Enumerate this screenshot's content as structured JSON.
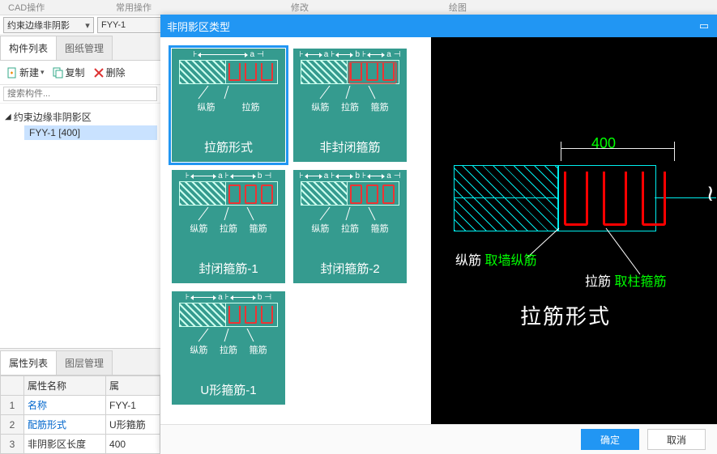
{
  "menu": {
    "cad": "CAD操作",
    "tools": "操作",
    "common": "常用操作",
    "mod": "修改",
    "draw": "绘图"
  },
  "combos": {
    "category": "约束边缘非阴影",
    "item": "FYY-1"
  },
  "left": {
    "tabs": {
      "components": "构件列表",
      "drawings": "图纸管理"
    },
    "toolbar": {
      "new": "新建",
      "copy": "复制",
      "delete": "删除"
    },
    "search_placeholder": "搜索构件...",
    "tree": {
      "root": "约束边缘非阴影区",
      "child": "FYY-1 [400]"
    }
  },
  "props": {
    "tabs": {
      "attrs": "属性列表",
      "layers": "图层管理"
    },
    "headers": {
      "name": "属性名称",
      "value": "属"
    },
    "rows": [
      {
        "n": "1",
        "k": "名称",
        "v": "FYY-1",
        "link": true
      },
      {
        "n": "2",
        "k": "配筋形式",
        "v": "U形箍筋",
        "link": true
      },
      {
        "n": "3",
        "k": "非阴影区长度",
        "v": "400",
        "link": false
      }
    ]
  },
  "dialog": {
    "title": "非阴影区类型",
    "ok": "确定",
    "cancel": "取消",
    "options": [
      {
        "title": "拉筋形式",
        "dims": [
          "a"
        ],
        "labels": [
          "纵筋",
          "拉筋"
        ],
        "bars": 3,
        "closed": false,
        "hoop": false
      },
      {
        "title": "非封闭箍筋",
        "dims": [
          "a",
          "b",
          "a"
        ],
        "labels": [
          "纵筋",
          "拉筋",
          "箍筋"
        ],
        "bars": 3,
        "closed": false,
        "hoop": true
      },
      {
        "title": "封闭箍筋-1",
        "dims": [
          "a",
          "b"
        ],
        "labels": [
          "纵筋",
          "拉筋",
          "箍筋"
        ],
        "bars": 3,
        "closed": true,
        "hoop": false
      },
      {
        "title": "封闭箍筋-2",
        "dims": [
          "a",
          "b",
          "a"
        ],
        "labels": [
          "纵筋",
          "拉筋",
          "箍筋"
        ],
        "bars": 3,
        "closed": true,
        "hoop": false
      },
      {
        "title": "U形箍筋-1",
        "dims": [
          "a",
          "b"
        ],
        "labels": [
          "纵筋",
          "拉筋",
          "箍筋"
        ],
        "bars": 3,
        "closed": false,
        "hoop": false
      }
    ]
  },
  "preview": {
    "dim": "400",
    "l1": "纵筋",
    "l1v": "取墙纵筋",
    "l2": "拉筋",
    "l2v": "取柱箍筋",
    "title": "拉筋形式"
  }
}
